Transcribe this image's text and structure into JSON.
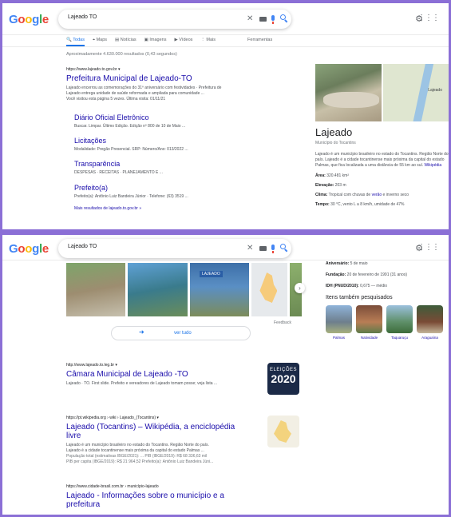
{
  "logo": [
    "G",
    "o",
    "o",
    "g",
    "l",
    "e"
  ],
  "logo_colors": [
    "#4285f4",
    "#ea4335",
    "#fbbc05",
    "#4285f4",
    "#34a853",
    "#ea4335"
  ],
  "search": {
    "query": "Lajeado TO"
  },
  "tabs": [
    "Todas",
    "Maps",
    "Notícias",
    "Imagens",
    "Vídeos",
    "Mais",
    "Ferramentas"
  ],
  "stats": "Aproximadamente 4.630.000 resultados (0,43 segundos)",
  "result1": {
    "url": "https://www.lajeado.to.gov.br ▾",
    "title": "Prefeitura Municipal de Lajeado-TO",
    "snippet1": "Lajeado encerrou as comemorações do 31º aniversário com festividades · Prefeitura de",
    "snippet2": "Lajeado entrega unidade de saúde reformada e ampliada para comunidade ...",
    "snippet3": "Você visitou esta página 5 vezes. Última visita: 01/11/21"
  },
  "sitelinks": [
    {
      "title": "Diário Oficial Eletrônico",
      "desc": "Buscar. Limpar. Último Edição. Edição nº 800 de 10 de Maio ..."
    },
    {
      "title": "Licitações",
      "desc": "Modalidade: Pregão Presencial. SRP: Número/Ano: 013/2022 ..."
    },
    {
      "title": "Transparência",
      "desc": "DESPESAS · RECEITAS · PLANEJAMENTO E ..."
    },
    {
      "title": "Prefeito(a)",
      "desc": "Prefeito(a): Antônio Luiz Bandeira Júnior · Telefone: (63) 3519 ..."
    }
  ],
  "more_results": "Mais resultados de lajeado.to.gov.br »",
  "kp": {
    "map_label": "Lajeado",
    "title": "Lajeado",
    "subtitle": "Município do Tocantins",
    "desc": "Lajeado é um município brasileiro no estado do Tocantins. Região Norte do país. Lajeado é a cidade tocantinense mais próxima da capital do estado Palmas, que fica localizada a uma distância de 55 km ao sul.",
    "desc_link": "Wikipédia",
    "area_label": "Área:",
    "area": "320.481 km²",
    "elev_label": "Elevação:",
    "elev": "203 m",
    "climate_label": "Clima:",
    "climate": "Tropical com chuvas de",
    "climate_link": "verão",
    "climate_tail": "e inverno seco",
    "temp_label": "Tempo:",
    "temp": "30 °C, vento L a 8 km/h, umidade de 47%"
  },
  "images": {
    "badge": "LAJEADO"
  },
  "see_all": "ver tudo",
  "feedback": "Feedback",
  "kp2": {
    "anniv_label": "Aniversário:",
    "anniv": "5 de maio",
    "found_label": "Fundação:",
    "found": "20 de fevereiro de 1991 (31 anos)",
    "idh_label": "IDH (PNUD/2010):",
    "idh": "0,675 — médio",
    "also_title": "Itens também pesquisados",
    "also": [
      "Palmas",
      "Natividade",
      "Taquaruçu",
      "Aragua­ína"
    ]
  },
  "result2": {
    "url": "http://www.lajeado.to.leg.br ▾",
    "title": "Câmara Municipal de Lajeado -TO",
    "snippet": "Lajeado · TO. First slide. Prefeito e vereadores de Lajeado tomam posse; veja lista ...",
    "thumb1": "ELEIÇÕES",
    "thumb2": "2020"
  },
  "result3": {
    "url": "https://pt.wikipedia.org › wiki › Lajeado_(Tocantins) ▾",
    "title": "Lajeado (Tocantins) – Wikipédia, a enciclopédia livre",
    "snippet1": "Lajeado é um município brasileiro no estado do Tocantins. Região Norte do país.",
    "snippet2": "Lajeado é a cidade tocantinense mais próxima da capital do estado Palmas ...",
    "meta1": "População total (estimativas IBGE/2021): ...   PIB (IBGE/2019): R$ 68 336,63 mil",
    "meta2": "PIB per capita (IBGE/2019): R$ 21 964,52    Prefeito(a): Antônio Luiz Bandeira Júni..."
  },
  "result4": {
    "url": "https://www.cidade-brasil.com.br › município-lajeado",
    "title": "Lajeado - Informações sobre o município e a prefeitura"
  }
}
